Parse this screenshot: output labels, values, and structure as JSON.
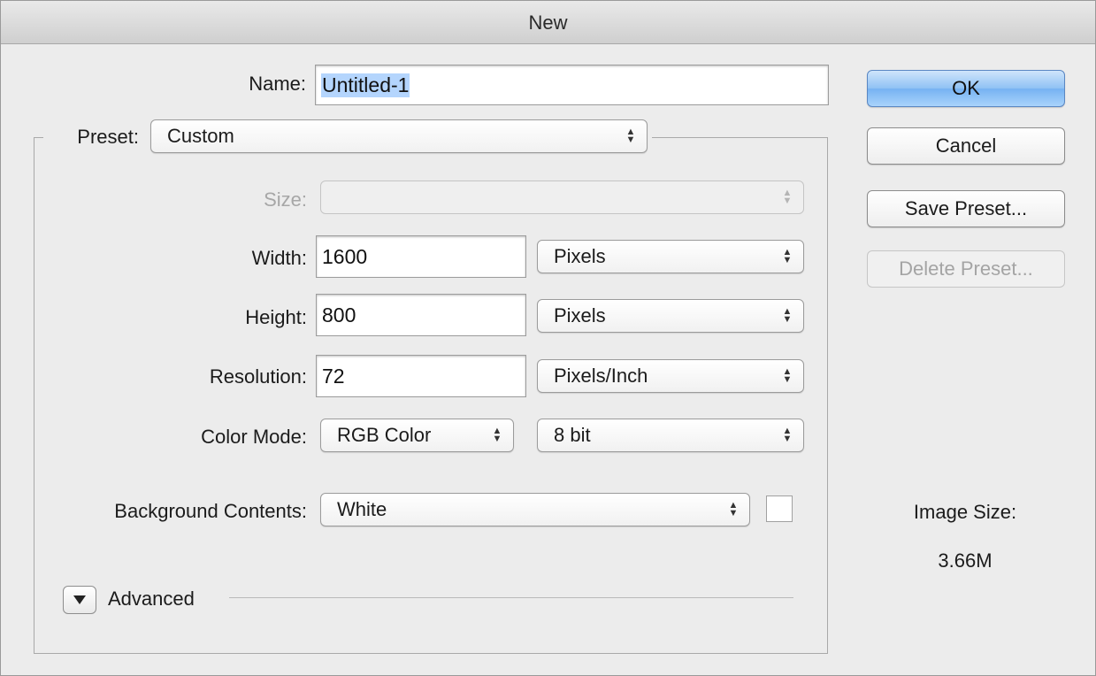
{
  "window": {
    "title": "New"
  },
  "name": {
    "label": "Name:",
    "value": "Untitled-1"
  },
  "preset": {
    "label": "Preset:",
    "value": "Custom"
  },
  "size": {
    "label": "Size:",
    "value": ""
  },
  "width": {
    "label": "Width:",
    "value": "1600",
    "unit": "Pixels"
  },
  "height": {
    "label": "Height:",
    "value": "800",
    "unit": "Pixels"
  },
  "resolution": {
    "label": "Resolution:",
    "value": "72",
    "unit": "Pixels/Inch"
  },
  "color_mode": {
    "label": "Color Mode:",
    "mode": "RGB Color",
    "depth": "8 bit"
  },
  "background": {
    "label": "Background Contents:",
    "value": "White",
    "swatch_color": "#ffffff"
  },
  "advanced": {
    "label": "Advanced",
    "icon": "disclosure-triangle-icon"
  },
  "buttons": {
    "ok": "OK",
    "cancel": "Cancel",
    "save_preset": "Save Preset...",
    "delete_preset": "Delete Preset..."
  },
  "image_size": {
    "label": "Image Size:",
    "value": "3.66M"
  },
  "colors": {
    "default_button": "#76b2f2",
    "selection_highlight": "#b4d5fd"
  }
}
